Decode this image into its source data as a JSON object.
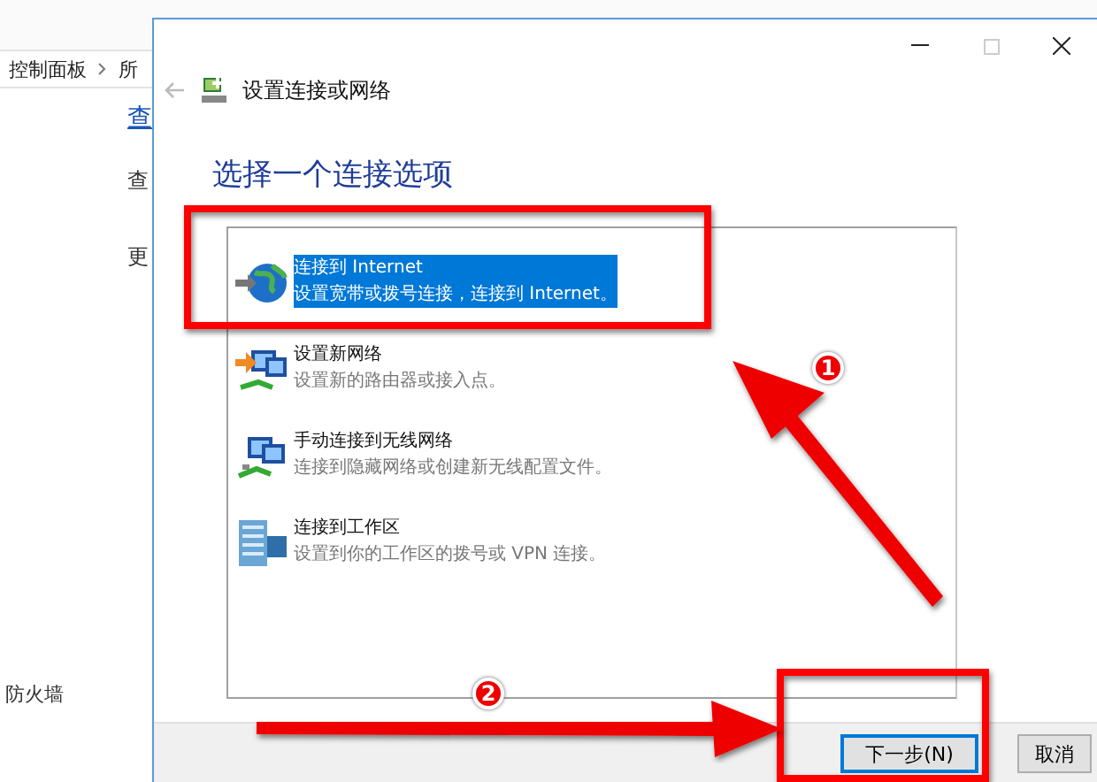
{
  "background_window": {
    "breadcrumb": [
      {
        "label": "控制面板"
      },
      {
        "label": "所"
      }
    ],
    "content_texts": [
      {
        "text": "查",
        "kind": "link"
      },
      {
        "text": "查",
        "kind": "text"
      },
      {
        "text": "更",
        "kind": "text"
      }
    ],
    "sidebar_items": [
      {
        "label": "防火墙"
      }
    ]
  },
  "dialog": {
    "title": "设置连接或网络",
    "heading": "选择一个连接选项",
    "options": [
      {
        "title": "连接到 Internet",
        "description": "设置宽带或拨号连接，连接到 Internet。",
        "kind": "globe",
        "selected": true
      },
      {
        "title": "设置新网络",
        "description": "设置新的路由器或接入点。",
        "kind": "setup",
        "selected": false
      },
      {
        "title": "手动连接到无线网络",
        "description": "连接到隐藏网络或创建新无线配置文件。",
        "kind": "wireless",
        "selected": false
      },
      {
        "title": "连接到工作区",
        "description": "设置到你的工作区的拨号或 VPN 连接。",
        "kind": "workplace",
        "selected": false
      }
    ],
    "buttons": [
      {
        "label": "下一步(N)",
        "default": true
      },
      {
        "label": "取消",
        "default": false
      }
    ]
  },
  "annotations": {
    "markers": [
      {
        "label": "1"
      },
      {
        "label": "2"
      }
    ]
  }
}
